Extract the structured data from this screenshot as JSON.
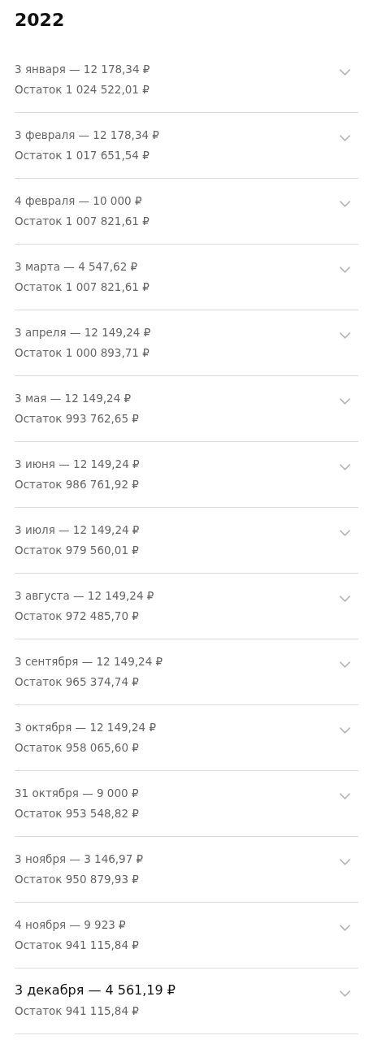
{
  "title": "2022",
  "payments": [
    {
      "kind": "past",
      "expanded": false,
      "title": "3 января — 12 178,34 ₽",
      "balance": "Остаток 1 024 522,01 ₽"
    },
    {
      "kind": "past",
      "expanded": false,
      "title": "3 февраля — 12 178,34 ₽",
      "balance": "Остаток 1 017 651,54 ₽"
    },
    {
      "kind": "past",
      "expanded": false,
      "title": "4 февраля — 10 000 ₽",
      "balance": "Остаток 1 007 821,61 ₽"
    },
    {
      "kind": "past",
      "expanded": false,
      "title": "3 марта — 4 547,62 ₽",
      "balance": "Остаток 1 007 821,61 ₽"
    },
    {
      "kind": "past",
      "expanded": false,
      "title": "3 апреля — 12 149,24 ₽",
      "balance": "Остаток 1 000 893,71 ₽"
    },
    {
      "kind": "past",
      "expanded": false,
      "title": "3 мая — 12 149,24 ₽",
      "balance": "Остаток 993 762,65 ₽"
    },
    {
      "kind": "past",
      "expanded": false,
      "title": "3 июня — 12 149,24 ₽",
      "balance": "Остаток 986 761,92 ₽"
    },
    {
      "kind": "past",
      "expanded": false,
      "title": "3 июля — 12 149,24 ₽",
      "balance": "Остаток 979 560,01 ₽"
    },
    {
      "kind": "past",
      "expanded": false,
      "title": "3 августа — 12 149,24 ₽",
      "balance": "Остаток 972 485,70 ₽"
    },
    {
      "kind": "past",
      "expanded": false,
      "title": "3 сентября — 12 149,24 ₽",
      "balance": "Остаток 965 374,74 ₽"
    },
    {
      "kind": "past",
      "expanded": false,
      "title": "3 октября — 12 149,24 ₽",
      "balance": "Остаток 958 065,60 ₽"
    },
    {
      "kind": "past",
      "expanded": false,
      "title": "31 октября — 9 000 ₽",
      "balance": "Остаток 953 548,82 ₽"
    },
    {
      "kind": "past",
      "expanded": false,
      "title": "3 ноября — 3 146,97 ₽",
      "balance": "Остаток 950 879,93 ₽"
    },
    {
      "kind": "past",
      "expanded": false,
      "title": "4 ноября — 9 923 ₽",
      "balance": "Остаток 941 115,84 ₽"
    },
    {
      "kind": "upcoming",
      "expanded": false,
      "title": "3 декабря — 4 561,19 ₽",
      "balance": "Остаток 941 115,84 ₽"
    }
  ]
}
